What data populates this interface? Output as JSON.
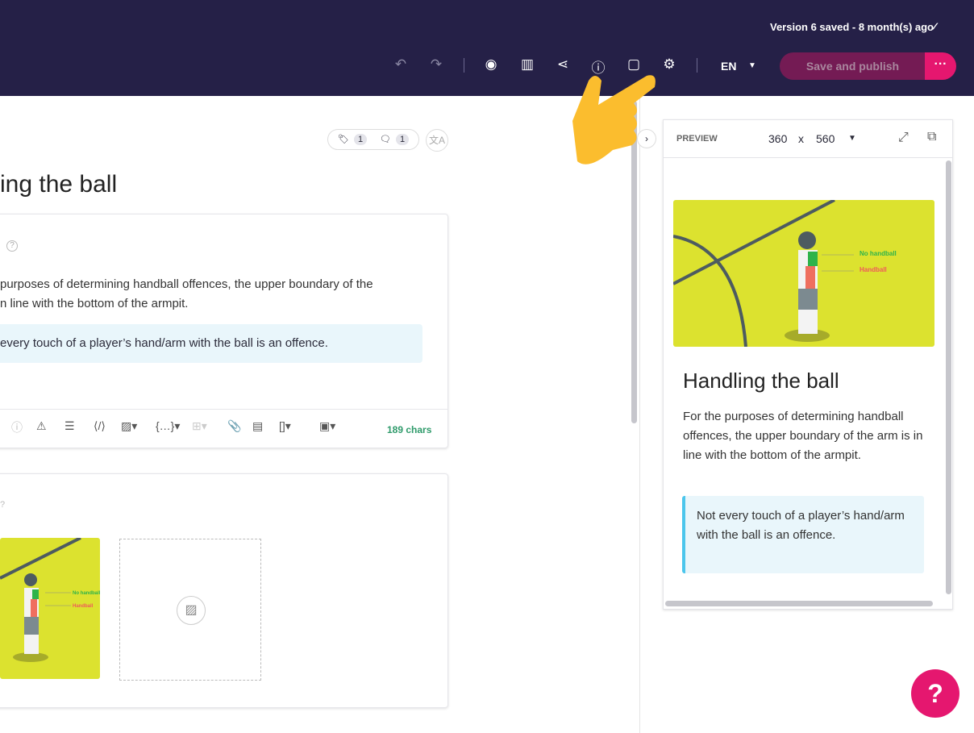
{
  "header": {
    "saved_status": "Version 6 saved - 8 month(s) ago",
    "language": "EN",
    "publish_label": "Save and publish",
    "more_label": "···"
  },
  "editor": {
    "tags_count": "1",
    "comments_count": "1",
    "title": "ing the ball",
    "paragraph_lines": [
      "purposes of determining handball offences, the upper boundary of the",
      "n line with the bottom of the armpit."
    ],
    "note": "every touch of a player’s hand/arm with the ball is an offence.",
    "char_count": "189 chars"
  },
  "illustration": {
    "label_green": "No handball",
    "label_red": "Handball"
  },
  "preview": {
    "label": "PREVIEW",
    "width": "360",
    "x": "x",
    "height": "560",
    "title": "Handling the ball",
    "paragraph": "For the purposes of determining handball offences, the upper boundary of the arm is in line with the bottom of the armpit.",
    "note": "Not every touch of a player’s hand/arm with the ball is an offence."
  },
  "help_label": "?",
  "colors": {
    "header_bg": "#252047",
    "accent": "#e5176f",
    "publish_disabled": "#741b54",
    "pointer": "#fbbd2e",
    "illustration_bg": "#dce22f"
  }
}
